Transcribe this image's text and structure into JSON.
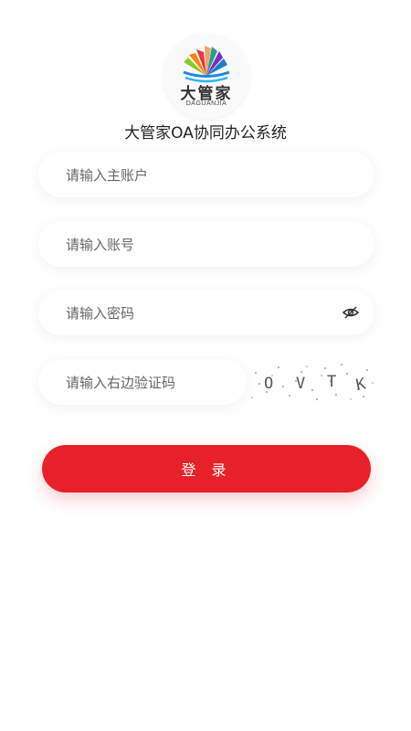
{
  "logo": {
    "name_cn": "大管家",
    "name_en": "DAGUANJIA"
  },
  "app_title": "大管家OA协同办公系统",
  "form": {
    "main_account_placeholder": "请输入主账户",
    "account_placeholder": "请输入账号",
    "password_placeholder": "请输入密码",
    "captcha_placeholder": "请输入右边验证码",
    "captcha_code": [
      "O",
      "V",
      "T",
      "K"
    ],
    "password_toggle_icon": "eye-off-icon",
    "login_label": "登 录"
  },
  "colors": {
    "primary": "#e8202a",
    "captcha_text": "#555555",
    "captcha_noise": "#7fb89a"
  }
}
